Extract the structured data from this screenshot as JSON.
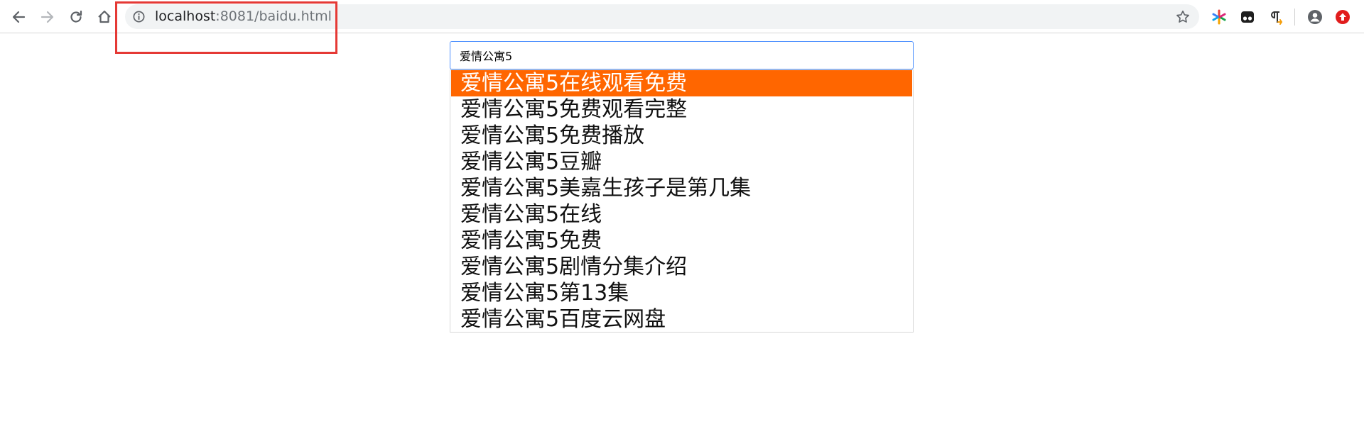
{
  "browser": {
    "url_host": "localhost",
    "url_path": ":8081/baidu.html",
    "icons": {
      "back": "back-arrow-icon",
      "forward": "forward-arrow-icon",
      "reload": "reload-icon",
      "home": "home-icon",
      "info": "info-icon",
      "star": "star-icon",
      "profile": "profile-icon"
    },
    "annotation_color": "#e53935"
  },
  "search": {
    "value": "爱情公寓5"
  },
  "suggestions": {
    "active_index": 0,
    "highlight_color": "#ff6600",
    "items": [
      "爱情公寓5在线观看免费",
      "爱情公寓5免费观看完整",
      "爱情公寓5免费播放",
      "爱情公寓5豆瓣",
      "爱情公寓5美嘉生孩子是第几集",
      "爱情公寓5在线",
      "爱情公寓5免费",
      "爱情公寓5剧情分集介绍",
      "爱情公寓5第13集",
      "爱情公寓5百度云网盘"
    ]
  }
}
